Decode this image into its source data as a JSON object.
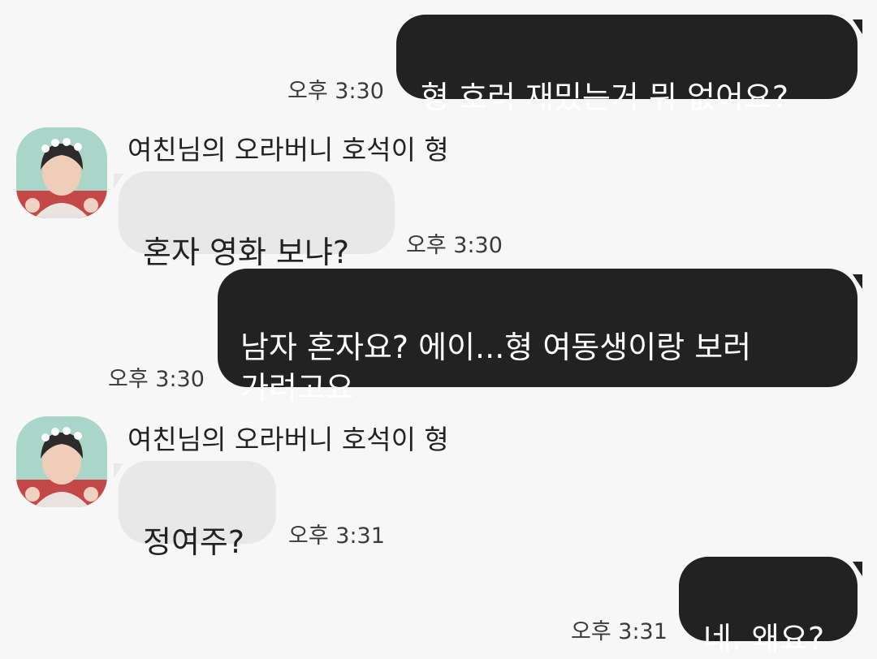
{
  "messages": [
    {
      "direction": "outgoing",
      "text": "형 호러 재밌는거 뭐 없어요?",
      "time": "오후 3:30"
    },
    {
      "direction": "incoming",
      "sender": "여친님의 오라버니 호석이 형",
      "avatar_icon": "profile-photo-icon",
      "text": "혼자 영화 보냐?",
      "time": "오후 3:30"
    },
    {
      "direction": "outgoing",
      "text": "남자 혼자요? 에이...형 여동생이랑 보러\n가려고요",
      "time": "오후 3:30"
    },
    {
      "direction": "incoming",
      "sender": "여친님의 오라버니 호석이 형",
      "avatar_icon": "profile-photo-icon",
      "text": "정여주?",
      "time": "오후 3:31"
    },
    {
      "direction": "outgoing",
      "text": "네. 왜요?",
      "time": "오후 3:31"
    }
  ],
  "colors": {
    "background": "#f7f7f7",
    "outgoing_bubble": "#222222",
    "incoming_bubble": "#e8e8e8"
  }
}
